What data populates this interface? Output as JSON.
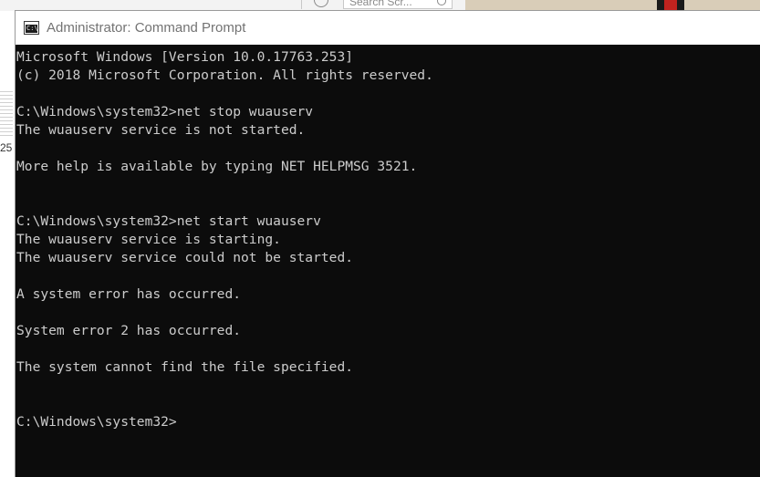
{
  "background": {
    "search_placeholder": "Search Scr...",
    "left_edge_fragment": "25"
  },
  "window": {
    "title": "Administrator: Command Prompt",
    "icon_label": "C:\\.",
    "colors": {
      "console_bg": "#0c0c0c",
      "console_text": "#cccccc",
      "titlebar_bg": "#ffffff",
      "title_text": "#737373"
    }
  },
  "console": {
    "lines": [
      "Microsoft Windows [Version 10.0.17763.253]",
      "(c) 2018 Microsoft Corporation. All rights reserved.",
      "",
      "C:\\Windows\\system32>net stop wuauserv",
      "The wuauserv service is not started.",
      "",
      "More help is available by typing NET HELPMSG 3521.",
      "",
      "",
      "C:\\Windows\\system32>net start wuauserv",
      "The wuauserv service is starting.",
      "The wuauserv service could not be started.",
      "",
      "A system error has occurred.",
      "",
      "System error 2 has occurred.",
      "",
      "The system cannot find the file specified.",
      "",
      "",
      "C:\\Windows\\system32>"
    ]
  }
}
